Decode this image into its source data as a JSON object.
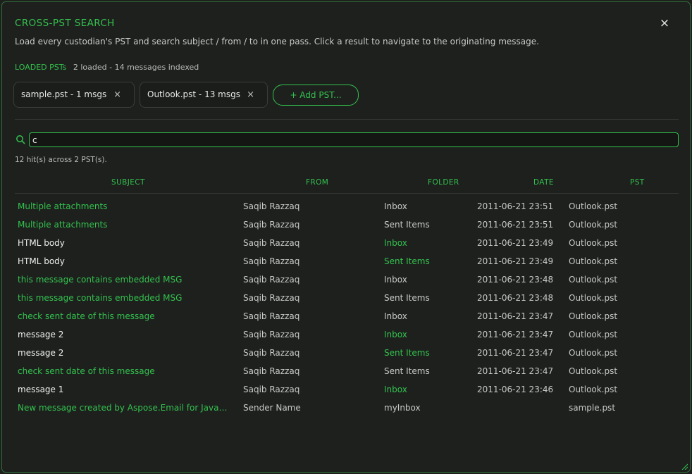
{
  "dialog": {
    "title": "CROSS-PST SEARCH",
    "close_icon": "×",
    "description": "Load every custodian's PST and search subject / from / to in one pass. Click a result to navigate to the originating message."
  },
  "loaded": {
    "label": "LOADED PSTs",
    "stats": "2 loaded - 14 messages indexed"
  },
  "chips": [
    {
      "label": "sample.pst - 1 msgs",
      "remove": "×"
    },
    {
      "label": "Outlook.pst - 13 msgs",
      "remove": "×"
    }
  ],
  "add_button": "+ Add PST...",
  "search": {
    "value": "c",
    "placeholder": ""
  },
  "hits": "12 hit(s) across 2 PST(s).",
  "columns": {
    "subject": "SUBJECT",
    "from": "FROM",
    "folder": "FOLDER",
    "date": "DATE",
    "pst": "PST"
  },
  "colors": {
    "accent": "#33c24d",
    "text": "#c6cac6",
    "background": "#1e201e"
  },
  "rows": [
    {
      "subject": "Multiple attachments",
      "from": "Saqib Razzaq",
      "folder": "Inbox",
      "date": "2011-06-21 23:51",
      "pst": "Outlook.pst"
    },
    {
      "subject": "Multiple attachments",
      "from": "Saqib Razzaq",
      "folder": "Sent Items",
      "date": "2011-06-21 23:51",
      "pst": "Outlook.pst"
    },
    {
      "subject": "HTML body",
      "from": "Saqib Razzaq",
      "folder": "Inbox",
      "date": "2011-06-21 23:49",
      "pst": "Outlook.pst"
    },
    {
      "subject": "HTML body",
      "from": "Saqib Razzaq",
      "folder": "Sent Items",
      "date": "2011-06-21 23:49",
      "pst": "Outlook.pst"
    },
    {
      "subject": "this message contains embedded MSG",
      "from": "Saqib Razzaq",
      "folder": "Inbox",
      "date": "2011-06-21 23:48",
      "pst": "Outlook.pst"
    },
    {
      "subject": "this message contains embedded MSG",
      "from": "Saqib Razzaq",
      "folder": "Sent Items",
      "date": "2011-06-21 23:48",
      "pst": "Outlook.pst"
    },
    {
      "subject": "check sent date of this message",
      "from": "Saqib Razzaq",
      "folder": "Inbox",
      "date": "2011-06-21 23:47",
      "pst": "Outlook.pst"
    },
    {
      "subject": "message 2",
      "from": "Saqib Razzaq",
      "folder": "Inbox",
      "date": "2011-06-21 23:47",
      "pst": "Outlook.pst"
    },
    {
      "subject": "message 2",
      "from": "Saqib Razzaq",
      "folder": "Sent Items",
      "date": "2011-06-21 23:47",
      "pst": "Outlook.pst"
    },
    {
      "subject": "check sent date of this message",
      "from": "Saqib Razzaq",
      "folder": "Sent Items",
      "date": "2011-06-21 23:47",
      "pst": "Outlook.pst"
    },
    {
      "subject": "message 1",
      "from": "Saqib Razzaq",
      "folder": "Inbox",
      "date": "2011-06-21 23:46",
      "pst": "Outlook.pst"
    },
    {
      "subject": "New message created by Aspose.Email for Java(Asp...",
      "from": "Sender Name",
      "folder": "myInbox",
      "date": "",
      "pst": "sample.pst"
    }
  ]
}
